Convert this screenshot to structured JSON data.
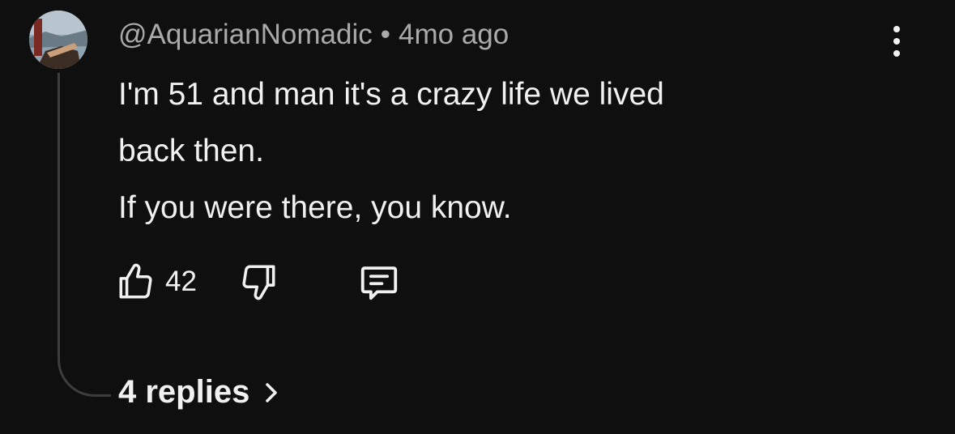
{
  "comment": {
    "author": "@AquarianNomadic",
    "separator": "•",
    "timestamp": "4mo ago",
    "lines": [
      "I'm 51 and man it's a crazy life we lived",
      "back then.",
      "If you were there, you know."
    ],
    "like_count": "42",
    "replies_label": "4 replies"
  },
  "icons": {
    "like": "thumbs-up-icon",
    "dislike": "thumbs-down-icon",
    "reply": "comment-icon",
    "menu": "more-vertical-icon",
    "replies_chevron": "chevron-right-icon"
  },
  "colors": {
    "background": "#0f0f0f",
    "primary_text": "#f1f1f1",
    "secondary_text": "#aaaaaa",
    "thread_line": "#3d3d3d"
  }
}
